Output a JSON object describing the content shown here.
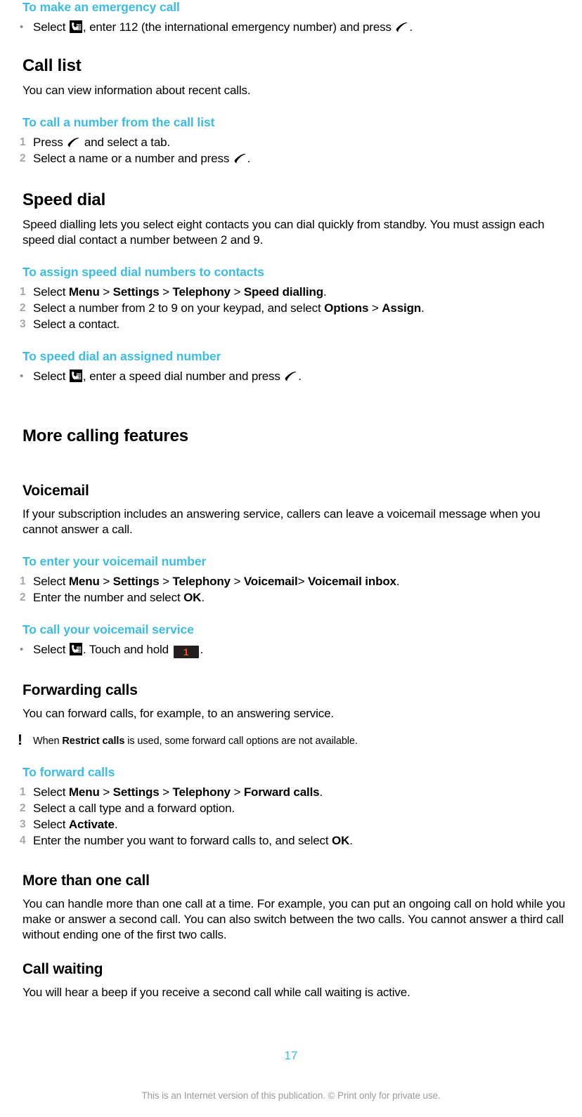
{
  "document": {
    "page_number": "17",
    "footer_note": "This is an Internet version of this publication. © Print only for private use.",
    "accent_color": "#3cbce4",
    "key_badge_bg": "#231f1e",
    "key_badge_fg": "#f04e23"
  },
  "icons": {
    "keypad": "keypad-icon",
    "call": "call-icon",
    "note": "exclamation-icon"
  },
  "sections": {
    "emergency": {
      "proc_heading": "To make an emergency call",
      "bullet_marker": "•",
      "step_a": "Select ",
      "step_b": ", enter 112 (the international emergency number) and press ",
      "step_c": "."
    },
    "call_list": {
      "heading": "Call list",
      "body": "You can view information about recent calls.",
      "proc_heading": "To call a number from the call list",
      "steps": [
        {
          "marker": "1",
          "a": "Press ",
          "b": " and select a tab."
        },
        {
          "marker": "2",
          "a": "Select a name or a number and press ",
          "b": "."
        }
      ]
    },
    "speed_dial": {
      "heading": "Speed dial",
      "body": "Speed dialling lets you select eight contacts you can dial quickly from standby. You must assign each speed dial contact a number between 2 and 9.",
      "assign": {
        "proc_heading": "To assign speed dial numbers to contacts",
        "step1": {
          "marker": "1",
          "pre": "Select ",
          "b1": "Menu",
          "gt1": " > ",
          "b2": "Settings",
          "gt2": " > ",
          "b3": "Telephony",
          "gt3": " > ",
          "b4": "Speed dialling",
          "post": "."
        },
        "step2": {
          "marker": "2",
          "pre": "Select a number from 2 to 9 on your keypad, and select ",
          "b1": "Options",
          "gt1": " > ",
          "b2": "Assign",
          "post": "."
        },
        "step3": {
          "marker": "3",
          "text": "Select a contact."
        }
      },
      "use": {
        "proc_heading": "To speed dial an assigned number",
        "bullet_marker": "•",
        "a": "Select ",
        "b": ", enter a speed dial number and press ",
        "c": "."
      }
    },
    "more_calling": {
      "heading": "More calling features"
    },
    "voicemail": {
      "heading": "Voicemail",
      "body": "If your subscription includes an answering service, callers can leave a voicemail message when you cannot answer a call.",
      "enter": {
        "proc_heading": "To enter your voicemail number",
        "step1": {
          "marker": "1",
          "pre": "Select ",
          "b1": "Menu",
          "gt1": " > ",
          "b2": "Settings",
          "gt2": " > ",
          "b3": "Telephony",
          "gt3": " > ",
          "b4": "Voicemail",
          "gt4": "> ",
          "b5": "Voicemail inbox",
          "post": "."
        },
        "step2": {
          "marker": "2",
          "pre": "Enter the number and select ",
          "b1": "OK",
          "post": "."
        }
      },
      "call_service": {
        "proc_heading": "To call your voicemail service",
        "bullet_marker": "•",
        "a": "Select ",
        "b": ". Touch and hold ",
        "key": "1",
        "c": "."
      }
    },
    "forwarding": {
      "heading": "Forwarding calls",
      "body": "You can forward calls, for example, to an answering service.",
      "note": {
        "marker": "!",
        "pre": "When ",
        "b1": "Restrict calls",
        "post": " is used, some forward call options are not available."
      },
      "proc_heading": "To forward calls",
      "step1": {
        "marker": "1",
        "pre": "Select ",
        "b1": "Menu",
        "gt1": " > ",
        "b2": "Settings",
        "gt2": " > ",
        "b3": "Telephony",
        "gt3": " > ",
        "b4": "Forward calls",
        "post": "."
      },
      "step2": {
        "marker": "2",
        "text": "Select a call type and a forward option."
      },
      "step3": {
        "marker": "3",
        "pre": "Select ",
        "b1": "Activate",
        "post": "."
      },
      "step4": {
        "marker": "4",
        "pre": "Enter the number you want to forward calls to, and select ",
        "b1": "OK",
        "post": "."
      }
    },
    "more_than_one": {
      "heading": "More than one call",
      "body": "You can handle more than one call at a time. For example, you can put an ongoing call on hold while you make or answer a second call. You can also switch between the two calls. You cannot answer a third call without ending one of the first two calls."
    },
    "call_waiting": {
      "heading": "Call waiting",
      "body": "You will hear a beep if you receive a second call while call waiting is active."
    }
  }
}
